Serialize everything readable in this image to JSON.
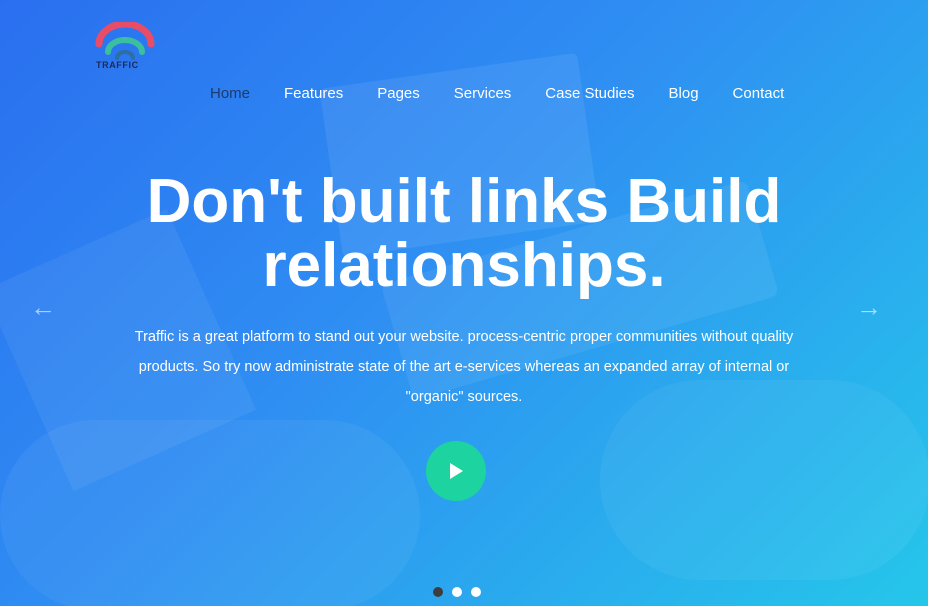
{
  "brand": {
    "name": "TRAFFIC",
    "colors": {
      "arc_outer": "#e84c67",
      "arc_inner": "#3bbf9e"
    }
  },
  "nav": {
    "items": [
      {
        "label": "Home",
        "active": true
      },
      {
        "label": "Features"
      },
      {
        "label": "Pages"
      },
      {
        "label": "Services"
      },
      {
        "label": "Case Studies"
      },
      {
        "label": "Blog"
      },
      {
        "label": "Contact"
      }
    ]
  },
  "hero": {
    "headline_line1": "Don't built links Build",
    "headline_line2": "relationships.",
    "description": "Traffic is a great platform to stand out your website. process-centric proper communities without quality products. So try now administrate state of the art e-services whereas an expanded array of internal or \"organic\" sources.",
    "play_button_icon": "play-icon",
    "play_color": "#1dd39f"
  },
  "carousel": {
    "prev_icon": "arrow-left-icon",
    "next_icon": "arrow-right-icon",
    "slides": 3,
    "active_slide": 1
  }
}
